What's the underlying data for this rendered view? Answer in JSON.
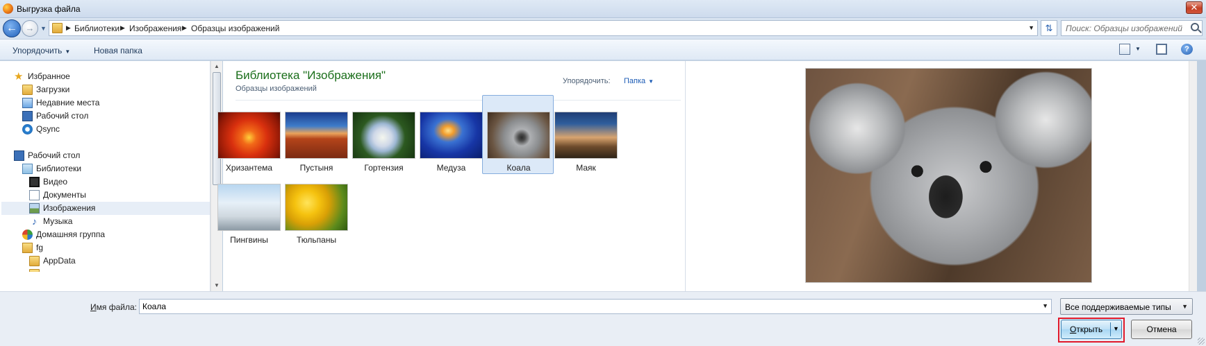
{
  "window": {
    "title": "Выгрузка файла",
    "close_label": "✕"
  },
  "address": {
    "crumbs": [
      "Библиотеки",
      "Изображения",
      "Образцы изображений"
    ],
    "search_placeholder": "Поиск: Образцы изображений"
  },
  "toolbar": {
    "organize_label": "Упорядочить",
    "new_folder_label": "Новая папка",
    "help_label": "?"
  },
  "sidebar": {
    "items": [
      {
        "label": "Избранное",
        "icon": "star-icon"
      },
      {
        "label": "Загрузки",
        "icon": "downloads-folder-icon"
      },
      {
        "label": "Недавние места",
        "icon": "recent-places-icon"
      },
      {
        "label": "Рабочий стол",
        "icon": "desktop-icon"
      },
      {
        "label": "Qsync",
        "icon": "qsync-icon"
      },
      {
        "label": "Рабочий стол",
        "icon": "desktop-icon"
      },
      {
        "label": "Библиотеки",
        "icon": "libraries-icon"
      },
      {
        "label": "Видео",
        "icon": "video-library-icon"
      },
      {
        "label": "Документы",
        "icon": "documents-library-icon"
      },
      {
        "label": "Изображения",
        "icon": "pictures-library-icon",
        "selected": true
      },
      {
        "label": "Музыка",
        "icon": "music-library-icon"
      },
      {
        "label": "Домашняя группа",
        "icon": "homegroup-icon"
      },
      {
        "label": "fg",
        "icon": "user-folder-icon"
      },
      {
        "label": "AppData",
        "icon": "folder-icon"
      }
    ]
  },
  "content": {
    "library_title": "Библиотека \"Изображения\"",
    "library_subtitle": "Образцы изображений",
    "arrange_label": "Упорядочить:",
    "arrange_value": "Папка",
    "files": [
      {
        "name": "Хризантема"
      },
      {
        "name": "Пустыня"
      },
      {
        "name": "Гортензия"
      },
      {
        "name": "Медуза"
      },
      {
        "name": "Коала",
        "selected": true
      },
      {
        "name": "Маяк"
      },
      {
        "name": "Пингвины"
      },
      {
        "name": "Тюльпаны"
      }
    ]
  },
  "bottom": {
    "filename_label_underlined": "И",
    "filename_label_rest": "мя файла:",
    "filename_value": "Коала",
    "filetype_value": "Все поддерживаемые типы",
    "open_label_underlined": "О",
    "open_label_rest": "ткрыть",
    "cancel_label": "Отмена"
  },
  "colors": {
    "library_title": "#1a6e1a",
    "link_blue": "#1c5bb5",
    "selection": "#dce9f8",
    "highlight_red": "#e0182a"
  }
}
